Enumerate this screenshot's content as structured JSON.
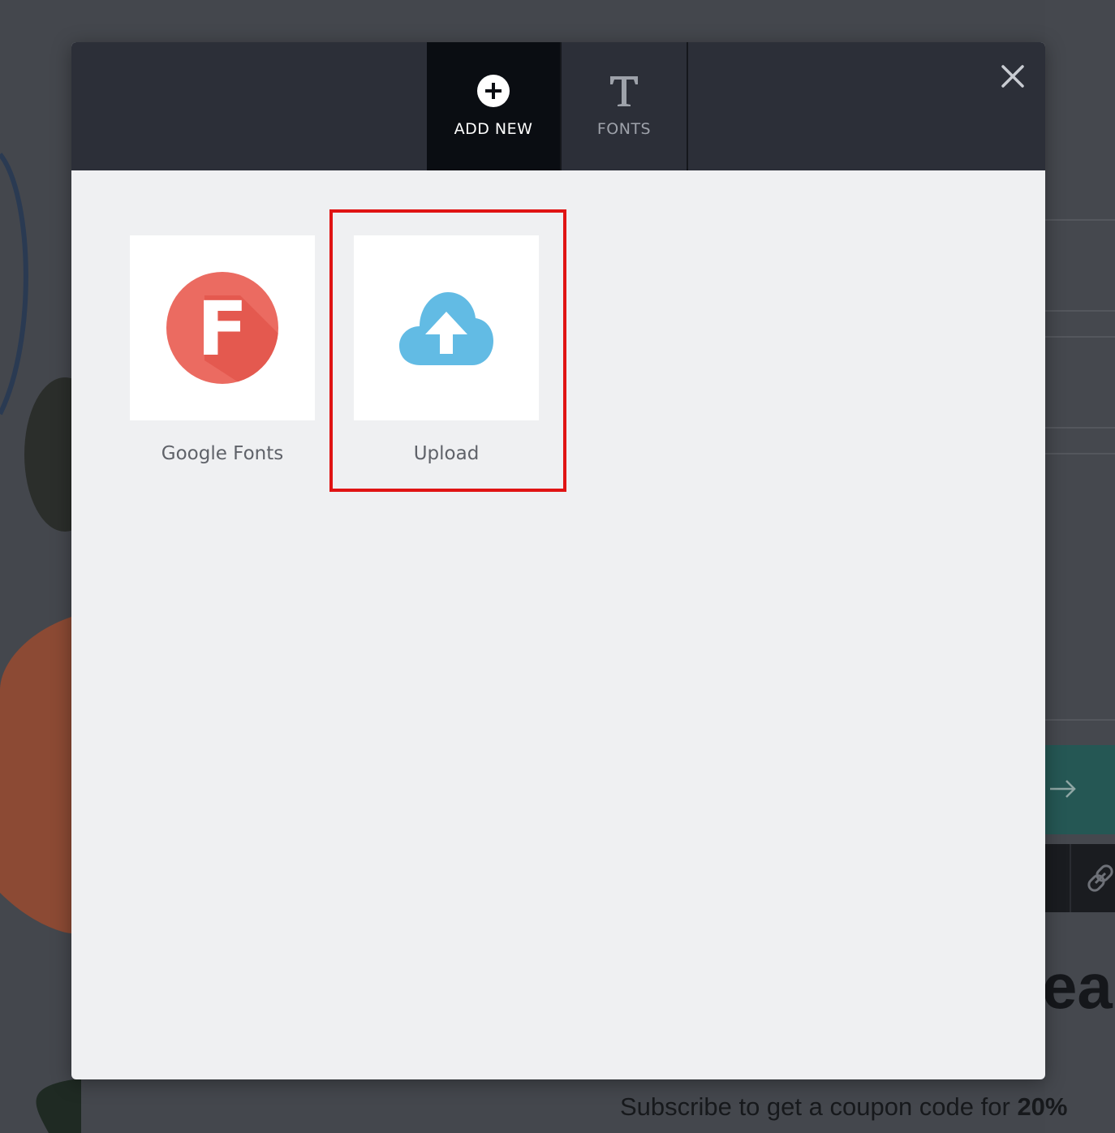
{
  "modal": {
    "tabs": [
      {
        "label": "ADD NEW",
        "icon": "plus-circle-icon",
        "active": true
      },
      {
        "label": "FONTS",
        "icon": "text-t-icon",
        "active": false
      }
    ],
    "close_icon": "close-icon",
    "cards": [
      {
        "label": "Google Fonts",
        "icon": "google-fonts-icon",
        "icon_letter": "F",
        "icon_color": "#e8594f"
      },
      {
        "label": "Upload",
        "icon": "cloud-upload-icon",
        "icon_color": "#62bbe4"
      }
    ],
    "highlight_color": "#e01414",
    "header_color": "#2c2f38",
    "active_tab_color": "#0a0d12"
  },
  "background": {
    "heading_fragment": "ea",
    "subscribe_text": "Subscribe to get a coupon code for ",
    "subscribe_bold": "20%"
  }
}
